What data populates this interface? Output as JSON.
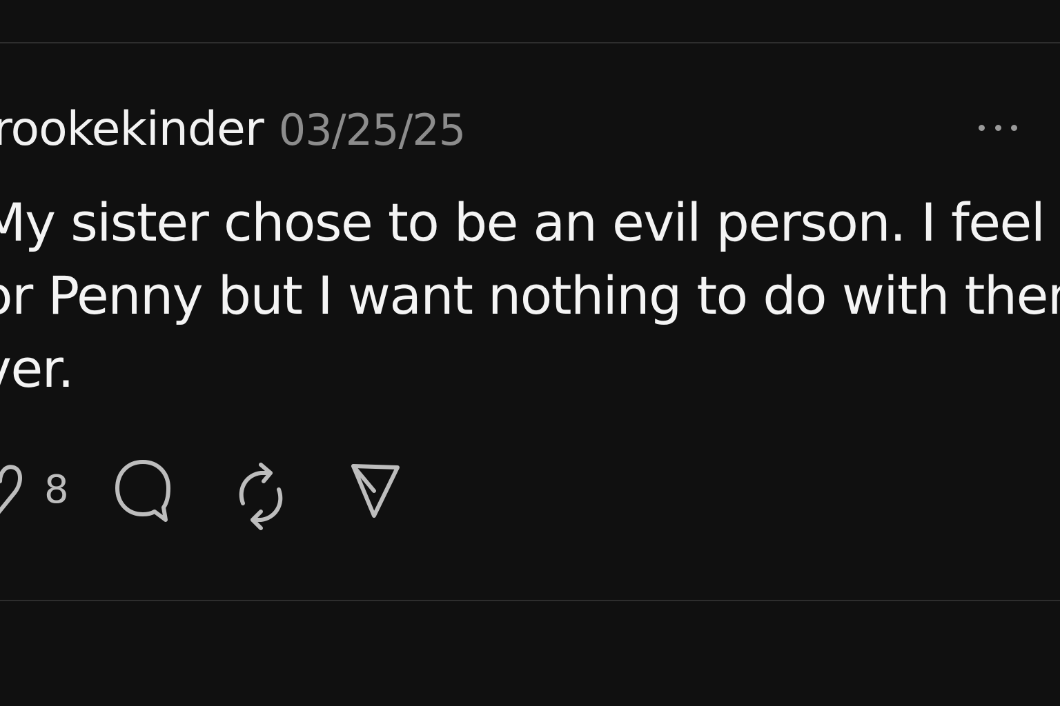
{
  "post": {
    "username": "rookekinder",
    "timestamp": "03/25/25",
    "body_lines": [
      "My sister chose to be an evil person. I feel bad",
      "or Penny but I want nothing to do with them",
      "ver."
    ],
    "more_label": "..."
  },
  "actions": {
    "like_count": "8",
    "icons": [
      "heart-icon",
      "comment-icon",
      "repost-icon",
      "share-icon"
    ]
  },
  "colors": {
    "background": "#101010",
    "text": "#f4f4f4",
    "muted": "#8c8c8c",
    "icon": "#bdbdbd",
    "divider": "#2e2e2e"
  }
}
